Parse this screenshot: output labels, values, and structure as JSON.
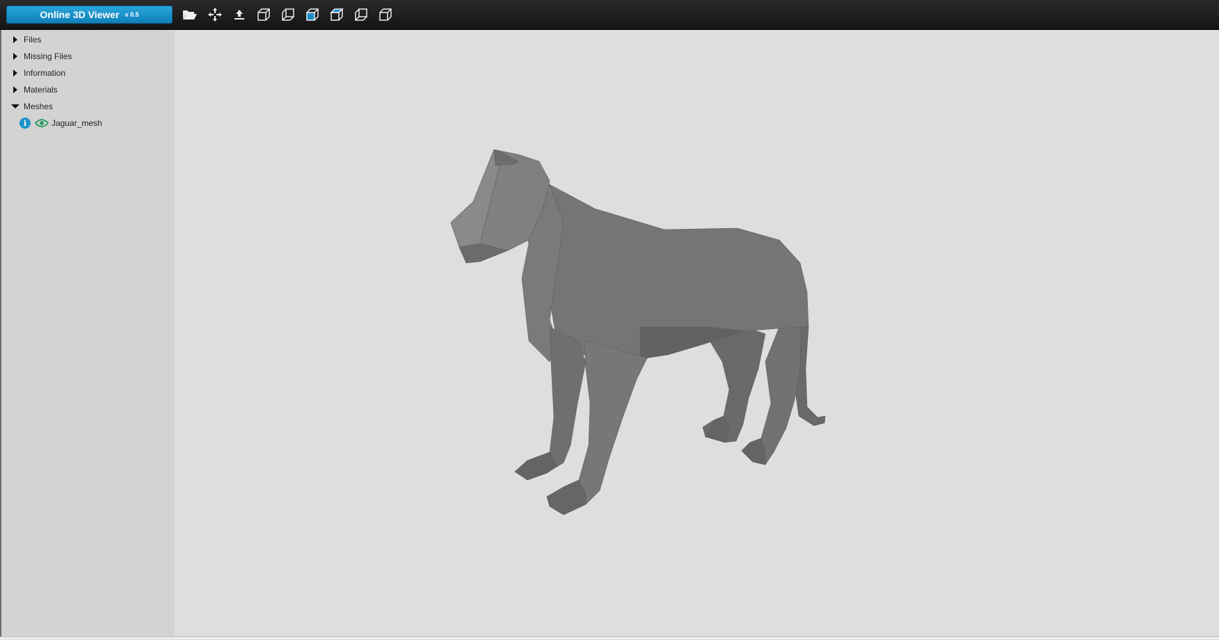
{
  "app": {
    "title": "Online 3D Viewer",
    "version": "v 0.5",
    "accent_color": "#1b8fc8"
  },
  "toolbar": {
    "buttons": [
      {
        "name": "open-folder-icon"
      },
      {
        "name": "fit-in-window-icon"
      },
      {
        "name": "up-vector-icon"
      },
      {
        "name": "view-front-cube-icon"
      },
      {
        "name": "view-back-cube-icon"
      },
      {
        "name": "view-left-cube-icon"
      },
      {
        "name": "view-right-cube-icon"
      },
      {
        "name": "view-top-cube-icon"
      },
      {
        "name": "view-bottom-cube-icon"
      }
    ]
  },
  "sidebar": {
    "items": [
      {
        "label": "Files",
        "expanded": false
      },
      {
        "label": "Missing Files",
        "expanded": false
      },
      {
        "label": "Information",
        "expanded": false
      },
      {
        "label": "Materials",
        "expanded": false
      },
      {
        "label": "Meshes",
        "expanded": true
      }
    ],
    "meshes": [
      {
        "label": "Jaguar_mesh",
        "visible": true
      }
    ]
  },
  "viewport": {
    "background": "#dedede",
    "model_color": "#6e6e6e"
  }
}
